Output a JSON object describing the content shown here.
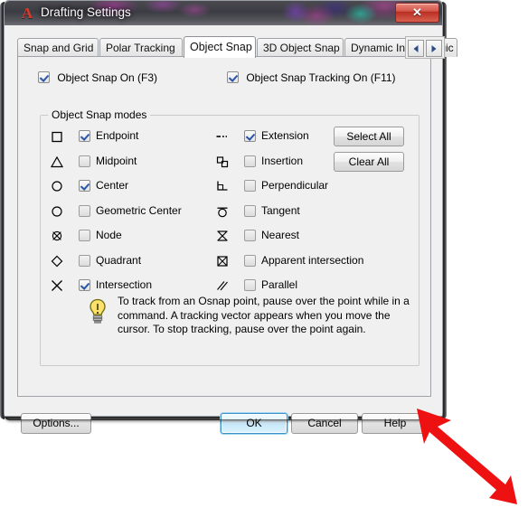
{
  "window": {
    "title": "Drafting Settings",
    "logo_icon": "autocad-a-icon",
    "close_label": "✕"
  },
  "tabs": [
    {
      "label": "Snap and Grid",
      "active": false
    },
    {
      "label": "Polar Tracking",
      "active": false
    },
    {
      "label": "Object Snap",
      "active": true
    },
    {
      "label": "3D Object Snap",
      "active": false
    },
    {
      "label": "Dynamic Input",
      "active": false
    },
    {
      "label": "Quic",
      "active": false
    }
  ],
  "tab_nav": {
    "prev_icon": "chevron-left-icon",
    "next_icon": "chevron-right-icon"
  },
  "top_options": [
    {
      "label": "Object Snap On (F3)",
      "checked": true
    },
    {
      "label": "Object Snap Tracking On (F11)",
      "checked": true
    }
  ],
  "group": {
    "title": "Object Snap modes",
    "left_modes": [
      {
        "label": "Endpoint",
        "checked": true,
        "icon": "square-icon"
      },
      {
        "label": "Midpoint",
        "checked": false,
        "icon": "triangle-icon"
      },
      {
        "label": "Center",
        "checked": true,
        "icon": "circle-icon"
      },
      {
        "label": "Geometric Center",
        "checked": false,
        "icon": "circle-icon"
      },
      {
        "label": "Node",
        "checked": false,
        "icon": "crossed-circle-icon"
      },
      {
        "label": "Quadrant",
        "checked": false,
        "icon": "diamond-icon"
      },
      {
        "label": "Intersection",
        "checked": true,
        "icon": "x-cross-icon"
      }
    ],
    "right_modes": [
      {
        "label": "Extension",
        "checked": true,
        "icon": "dashed-line-icon"
      },
      {
        "label": "Insertion",
        "checked": false,
        "icon": "insertion-icon"
      },
      {
        "label": "Perpendicular",
        "checked": false,
        "icon": "perpendicular-icon"
      },
      {
        "label": "Tangent",
        "checked": false,
        "icon": "tangent-icon"
      },
      {
        "label": "Nearest",
        "checked": false,
        "icon": "hourglass-icon"
      },
      {
        "label": "Apparent intersection",
        "checked": false,
        "icon": "boxed-x-icon"
      },
      {
        "label": "Parallel",
        "checked": false,
        "icon": "parallel-lines-icon"
      }
    ],
    "select_all_label": "Select All",
    "clear_all_label": "Clear All"
  },
  "tip": {
    "icon": "lightbulb-icon",
    "text": "To track from an Osnap point, pause over the point while in a command.  A tracking vector appears when you move the cursor.  To stop tracking, pause over the point again."
  },
  "footer": {
    "options_label": "Options...",
    "ok_label": "OK",
    "cancel_label": "Cancel",
    "help_label": "Help"
  },
  "annotation": {
    "arrow_color": "#ee1111",
    "points_to": "dialog-bottom-right-corner"
  },
  "colors": {
    "dialog_bg": "#f0f0f0",
    "accent_blue": "#2a55a8",
    "close_red": "#b82f22",
    "logo_red": "#d93a2b"
  }
}
